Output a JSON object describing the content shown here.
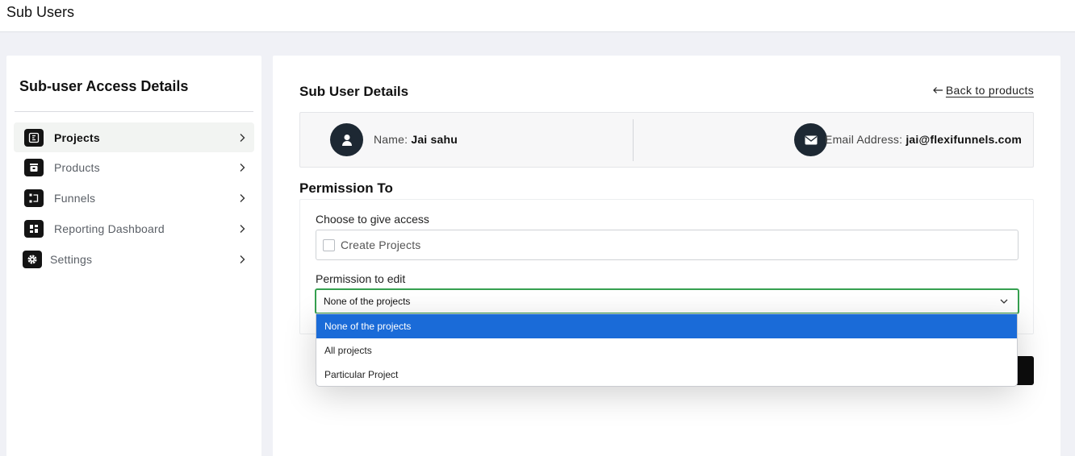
{
  "topbar": {
    "title": "Sub Users"
  },
  "sidebar": {
    "heading": "Sub-user Access Details",
    "items": [
      {
        "label": "Projects",
        "icon": "projects-icon",
        "active": true
      },
      {
        "label": "Products",
        "icon": "products-icon",
        "active": false
      },
      {
        "label": "Funnels",
        "icon": "funnels-icon",
        "active": false
      },
      {
        "label": "Reporting Dashboard",
        "icon": "dashboard-icon",
        "active": false
      },
      {
        "label": "Settings",
        "icon": "gear-icon",
        "active": false
      }
    ]
  },
  "main": {
    "title": "Sub User Details",
    "back_link": "Back to products",
    "user": {
      "name_label": "Name:",
      "name_value": "Jai sahu",
      "email_label": "Email Address:",
      "email_value": "jai@flexifunnels.com"
    },
    "permission": {
      "heading": "Permission To",
      "access_label": "Choose to give access",
      "checkbox_label": "Create Projects",
      "checkbox_checked": false,
      "edit_label": "Permission to edit",
      "select_value": "None of the projects",
      "options": [
        "None of the projects",
        "All projects",
        "Particular Project"
      ],
      "selected_index": 0
    }
  },
  "colors": {
    "accent_green": "#35a04f",
    "selected_blue": "#1a6bd8",
    "dark": "#1d2833"
  }
}
